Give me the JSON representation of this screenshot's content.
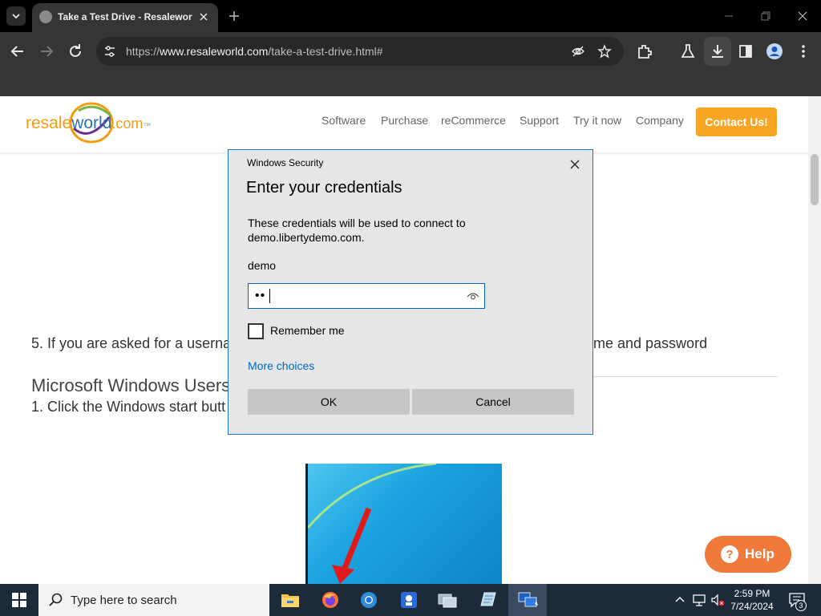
{
  "browser": {
    "tab_title": "Take a Test Drive - Resaleworld",
    "url_prefix": "https://",
    "url_host": "www.resaleworld.com",
    "url_path": "/take-a-test-drive.html#"
  },
  "site": {
    "logo_text_resale": "resale",
    "logo_text_world": "world",
    "logo_text_com": ".com",
    "logo_tm": "™",
    "nav": [
      "Software",
      "Purchase",
      "reCommerce",
      "Support",
      "Try it now",
      "Company"
    ],
    "contact_label": "Contact Us!",
    "step5_left": "5. If you are asked for a userna",
    "step5_right": "me and password",
    "ms_heading": "Microsoft Windows Users",
    "step1": "1. Click the Windows start butt",
    "help_label": "Help",
    "help_glyph": "?"
  },
  "dialog": {
    "caption": "Windows Security",
    "title": "Enter your credentials",
    "description": "These credentials will be used to connect to demo.libertydemo.com.",
    "username": "demo",
    "password_mask": "••",
    "remember_label": "Remember me",
    "more_choices": "More choices",
    "ok_label": "OK",
    "cancel_label": "Cancel"
  },
  "taskbar": {
    "search_placeholder": "Type here to search",
    "time": "2:59 PM",
    "date": "7/24/2024",
    "notification_count": "3"
  },
  "colors": {
    "accent_orange": "#f6a623",
    "help_orange": "#ef7a3b",
    "link_blue": "#0067c0",
    "logo_orange": "#f39c12",
    "logo_blue": "#2c6fb7"
  }
}
